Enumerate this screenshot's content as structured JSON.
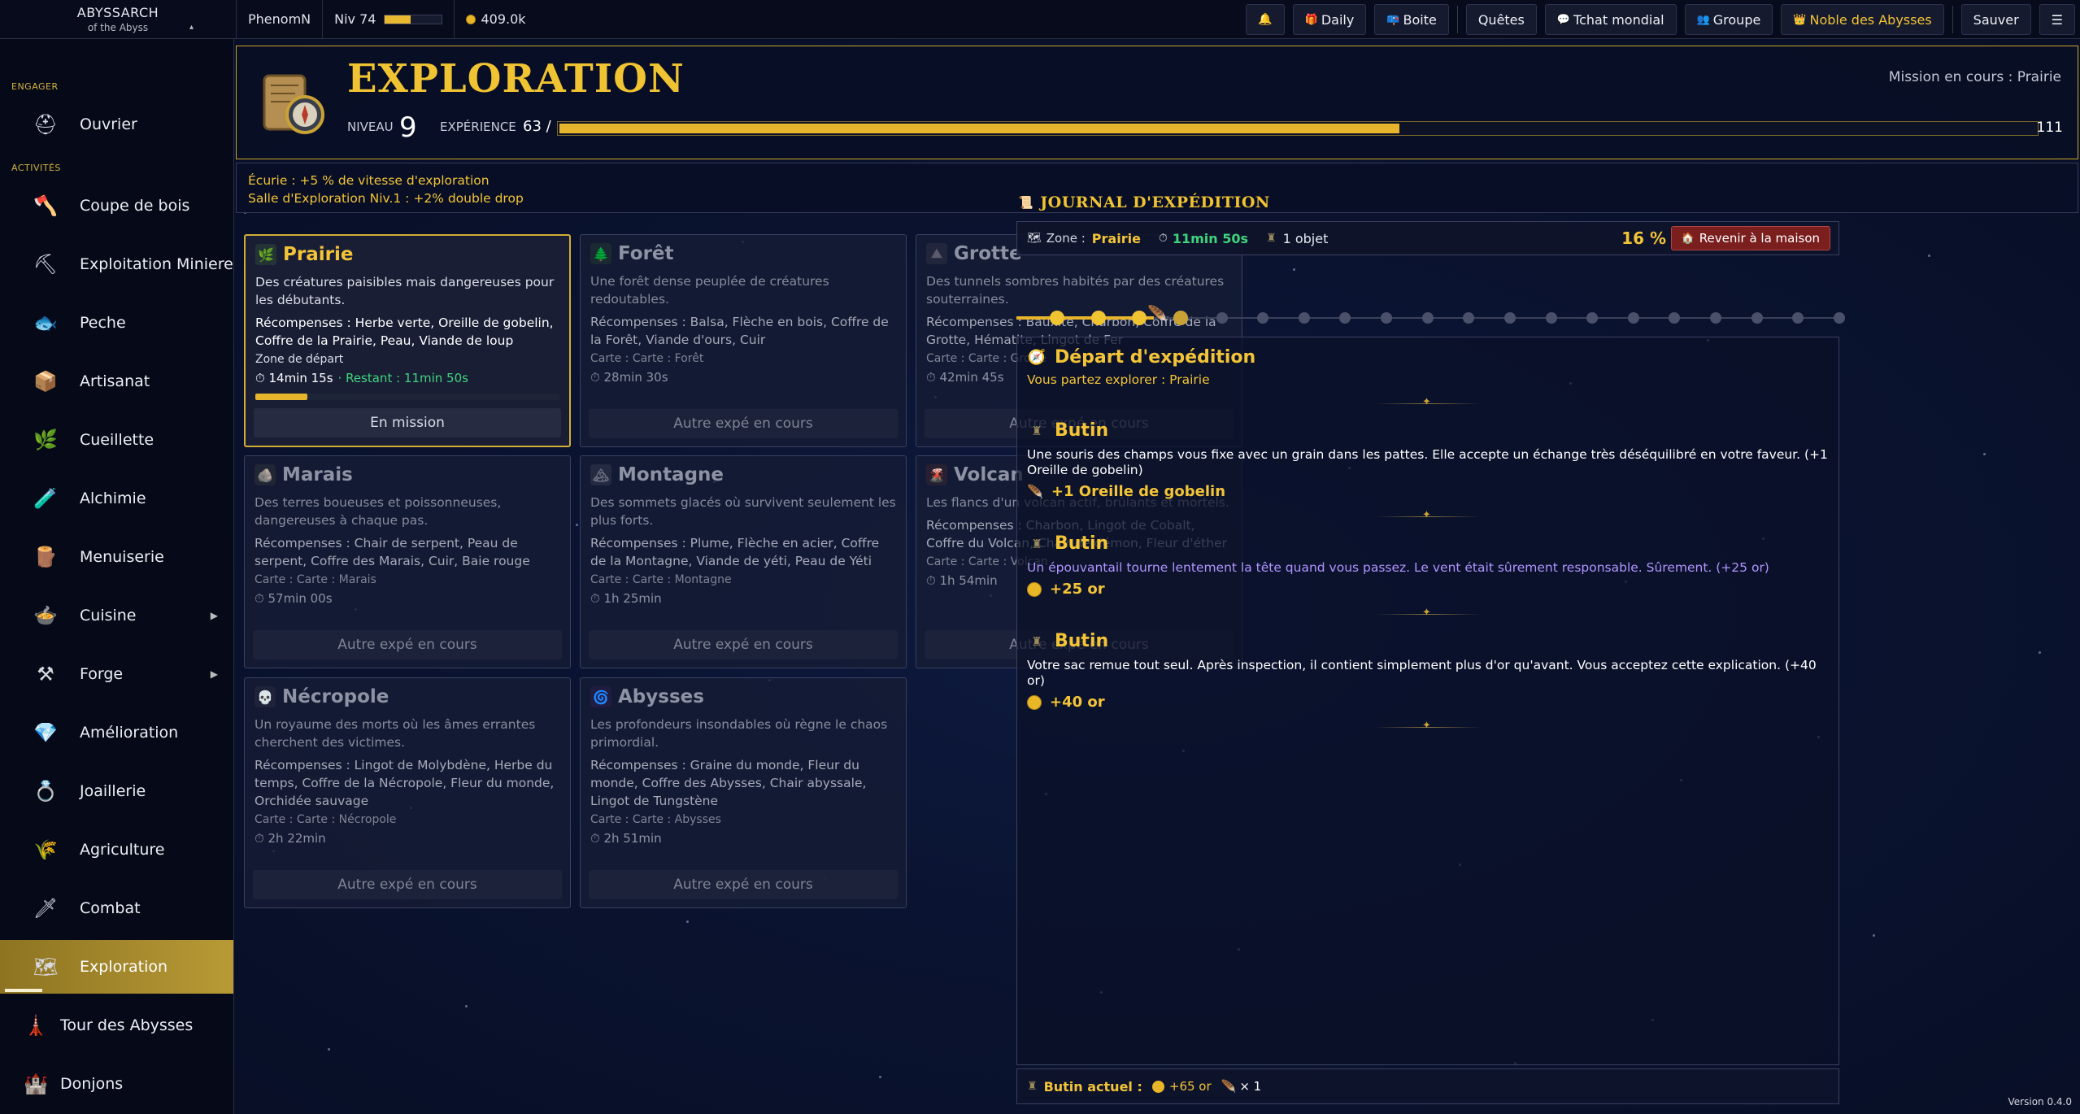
{
  "topbar": {
    "brand_name": "ABYSSARCH",
    "brand_sub": "of the Abyss",
    "player": "PhenomN",
    "level": "Niv 74",
    "level_progress": 0.45,
    "gold": "409.0k",
    "buttons": {
      "daily": "Daily",
      "boite": "Boite",
      "quetes": "Quêtes",
      "chat": "Tchat mondial",
      "groupe": "Groupe",
      "noble": "Noble des Abysses",
      "sauver": "Sauver"
    }
  },
  "sidebar": {
    "section_engager": "ENGAGER",
    "section_activites": "ACTIVITÉS",
    "items": [
      {
        "label": "Ouvrier",
        "icon": "worker-icon"
      },
      {
        "label": "Coupe de bois",
        "icon": "axe-icon"
      },
      {
        "label": "Exploitation Miniere",
        "icon": "pickaxe-icon"
      },
      {
        "label": "Peche",
        "icon": "fish-icon"
      },
      {
        "label": "Artisanat",
        "icon": "crate-icon"
      },
      {
        "label": "Cueillette",
        "icon": "herb-icon"
      },
      {
        "label": "Alchimie",
        "icon": "potion-icon"
      },
      {
        "label": "Menuiserie",
        "icon": "planks-icon"
      },
      {
        "label": "Cuisine",
        "icon": "pot-icon"
      },
      {
        "label": "Forge",
        "icon": "anvil-icon"
      },
      {
        "label": "Amélioration",
        "icon": "crystal-icon"
      },
      {
        "label": "Joaillerie",
        "icon": "gem-icon"
      },
      {
        "label": "Agriculture",
        "icon": "wheat-icon"
      },
      {
        "label": "Combat",
        "icon": "sword-icon"
      },
      {
        "label": "Exploration",
        "icon": "map-icon"
      },
      {
        "label": "Tour des Abysses",
        "icon": "tower-icon"
      },
      {
        "label": "Donjons",
        "icon": "dungeon-icon"
      }
    ]
  },
  "header": {
    "title": "EXPLORATION",
    "mission": "Mission en cours : Prairie",
    "level_label": "NIVEAU",
    "level_value": "9",
    "xp_label": "EXPÉRIENCE",
    "xp_value": "63 /",
    "xp_max": "111",
    "xp_progress": 0.57
  },
  "bonuses": [
    "Écurie : +5 % de vitesse d'exploration",
    "Salle d'Exploration Niv.1 : +2% double drop"
  ],
  "zones": [
    {
      "name": "Prairie",
      "desc": "Des créatures paisibles mais dangereuses pour les débutants.",
      "rewards": "Récompenses : Herbe verte, Oreille de gobelin, Coffre de la Prairie, Peau, Viande de loup",
      "map": "Zone de départ",
      "time": "14min 15s",
      "remaining": "· Restant : 11min 50s",
      "progress": 0.17,
      "button": "En mission",
      "active": true,
      "icon_color": "#4e8a3a"
    },
    {
      "name": "Forêt",
      "desc": "Une forêt dense peuplée de créatures redoutables.",
      "rewards": "Récompenses : Balsa, Flèche en bois, Coffre de la Forêt, Viande d'ours, Cuir",
      "map": "Carte : Carte : Forêt",
      "time": "28min 30s",
      "button": "Autre expé en cours",
      "icon_color": "#3c6a30"
    },
    {
      "name": "Grotte",
      "desc": "Des tunnels sombres habités par des créatures souterraines.",
      "rewards": "Récompenses : Bauxite, Charbon, Coffre de la Grotte, Hématite, Lingot de Fer",
      "map": "Carte : Carte : Grotte",
      "time": "42min 45s",
      "button": "Autre expé en cours",
      "icon_color": "#5a5a6a"
    },
    {
      "name": "Marais",
      "desc": "Des terres boueuses et poissonneuses, dangereuses à chaque pas.",
      "rewards": "Récompenses : Chair de serpent, Peau de serpent, Coffre des Marais, Cuir, Baie rouge",
      "map": "Carte : Carte : Marais",
      "time": "57min 00s",
      "button": "Autre expé en cours",
      "icon_color": "#5a5a40"
    },
    {
      "name": "Montagne",
      "desc": "Des sommets glacés où survivent seulement les plus forts.",
      "rewards": "Récompenses : Plume, Flèche en acier, Coffre de la Montagne, Viande de yéti, Peau de Yéti",
      "map": "Carte : Carte : Montagne",
      "time": "1h 25min",
      "button": "Autre expé en cours",
      "icon_color": "#6a7080"
    },
    {
      "name": "Volcan",
      "desc": "Les flancs d'un volcan actif, brûlants et mortels.",
      "rewards": "Récompenses : Charbon, Lingot de Cobalt, Coffre du Volcan, Chair de démon, Fleur d'éther",
      "map": "Carte : Carte : Volcan",
      "time": "1h 54min",
      "button": "Autre expé en cours",
      "icon_color": "#7a3a2a"
    },
    {
      "name": "Nécropole",
      "desc": "Un royaume des morts où les âmes errantes cherchent des victimes.",
      "rewards": "Récompenses : Lingot de Molybdène, Herbe du temps, Coffre de la Nécropole, Fleur du monde, Orchidée sauvage",
      "map": "Carte : Carte : Nécropole",
      "time": "2h 22min",
      "button": "Autre expé en cours",
      "icon_color": "#4a4a5a"
    },
    {
      "name": "Abysses",
      "desc": "Les profondeurs insondables où règne le chaos primordial.",
      "rewards": "Récompenses : Graine du monde, Fleur du monde, Coffre des Abysses, Chair abyssale, Lingot de Tungstène",
      "map": "Carte : Carte : Abysses",
      "time": "2h 51min",
      "button": "Autre expé en cours",
      "icon_color": "#5a2a7a"
    }
  ],
  "journal": {
    "title": "JOURNAL D'EXPÉDITION",
    "zone_label": "Zone :",
    "zone_value": "Prairie",
    "time_left": "11min 50s",
    "items": "1 objet",
    "percent": "16 %",
    "home_button": "Revenir à la maison",
    "steps_total": 20,
    "steps_done": 3,
    "entries": [
      {
        "type": "start",
        "title": "Départ d'expédition",
        "text": "Vous partez explorer : Prairie"
      },
      {
        "type": "loot",
        "title": "Butin",
        "text": "Une souris des champs vous fixe avec un grain dans les pattes. Elle accepte un échange très déséquilibré en votre faveur. (+1 Oreille de gobelin)",
        "gain": "+1  Oreille de gobelin",
        "gain_kind": "item"
      },
      {
        "type": "loot",
        "title": "Butin",
        "text": "Un épouvantail tourne lentement la tête quand vous passez. Le vent était sûrement responsable. Sûrement. (+25 or)",
        "gain": "+25 or",
        "gain_kind": "gold",
        "purple": true
      },
      {
        "type": "loot",
        "title": "Butin",
        "text": "Votre sac remue tout seul. Après inspection, il contient simplement plus d'or qu'avant. Vous acceptez cette explication. (+40 or)",
        "gain": "+40 or",
        "gain_kind": "gold"
      }
    ],
    "current_loot_label": "Butin actuel :",
    "current_gold": "+65 or",
    "current_items": "× 1"
  },
  "version": "Version 0.4.0",
  "colors": {
    "accent": "#f3c437",
    "green": "#3fd47b",
    "purple": "#b294ff",
    "danger": "#7a1e1e",
    "background": "#0a1330"
  }
}
